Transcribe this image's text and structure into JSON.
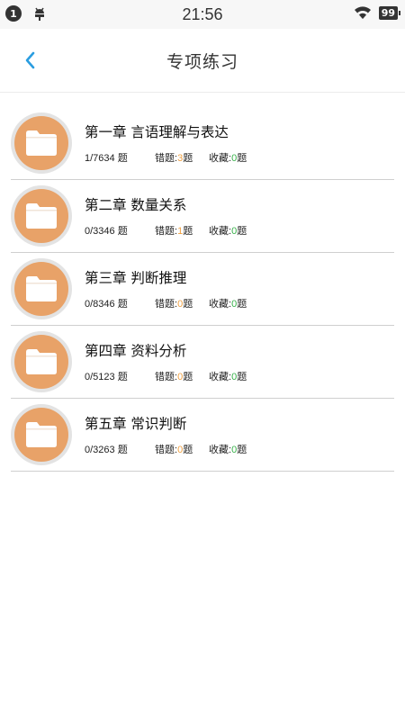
{
  "status_bar": {
    "notification_count": "1",
    "time": "21:56",
    "battery": "99"
  },
  "header": {
    "title": "专项练习"
  },
  "colors": {
    "accent_blue": "#2a9de0",
    "folder_orange": "#e8a268",
    "wrong_count": "#f0a040",
    "fav_count": "#38b24a"
  },
  "chapters": [
    {
      "title": "第一章 言语理解与表达",
      "progress": "1/7634 题",
      "wrong_label": "错题:",
      "wrong_count": "3",
      "wrong_unit": "题",
      "fav_label": "收藏:",
      "fav_count": "0",
      "fav_unit": "题"
    },
    {
      "title": "第二章 数量关系",
      "progress": "0/3346 题",
      "wrong_label": "错题:",
      "wrong_count": "1",
      "wrong_unit": "题",
      "fav_label": "收藏:",
      "fav_count": "0",
      "fav_unit": "题"
    },
    {
      "title": "第三章 判断推理",
      "progress": "0/8346 题",
      "wrong_label": "错题:",
      "wrong_count": "0",
      "wrong_unit": "题",
      "fav_label": "收藏:",
      "fav_count": "0",
      "fav_unit": "题"
    },
    {
      "title": "第四章 资料分析",
      "progress": "0/5123 题",
      "wrong_label": "错题:",
      "wrong_count": "0",
      "wrong_unit": "题",
      "fav_label": "收藏:",
      "fav_count": "0",
      "fav_unit": "题"
    },
    {
      "title": "第五章 常识判断",
      "progress": "0/3263 题",
      "wrong_label": "错题:",
      "wrong_count": "0",
      "wrong_unit": "题",
      "fav_label": "收藏:",
      "fav_count": "0",
      "fav_unit": "题"
    }
  ]
}
